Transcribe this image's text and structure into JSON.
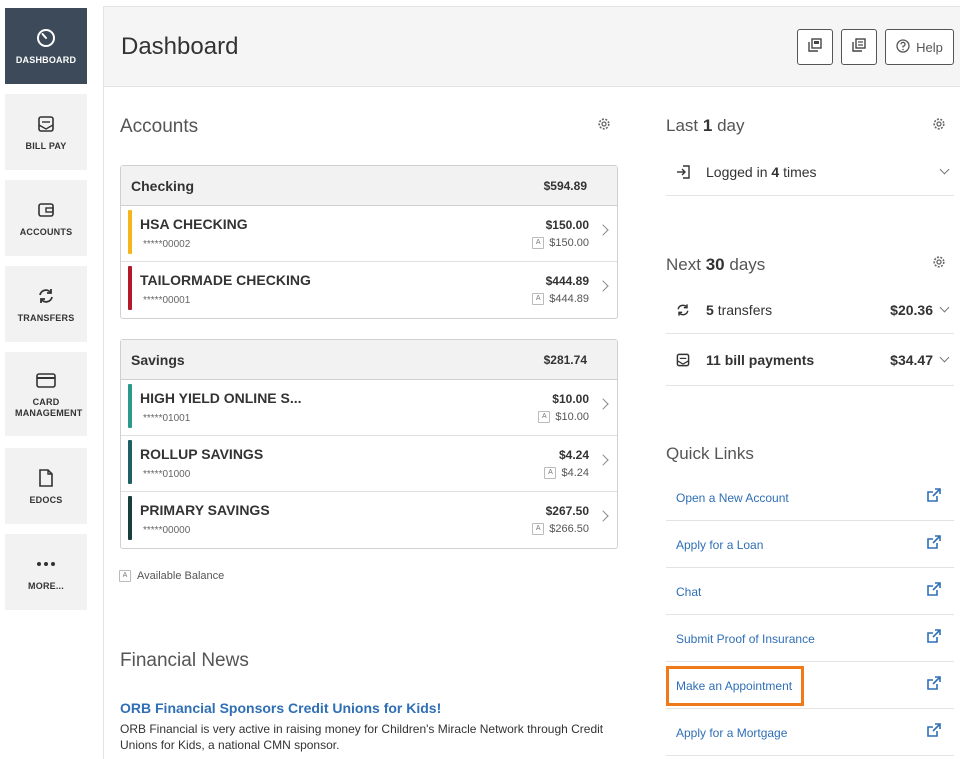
{
  "sidebar": {
    "items": [
      {
        "label": "DASHBOARD",
        "icon": "dashboard-gauge-icon",
        "active": true
      },
      {
        "label": "BILL PAY",
        "icon": "bill-pay-icon"
      },
      {
        "label": "ACCOUNTS",
        "icon": "wallet-icon"
      },
      {
        "label": "TRANSFERS",
        "icon": "transfer-arrows-icon"
      },
      {
        "label": "CARD MANAGEMENT",
        "icon": "credit-card-icon"
      },
      {
        "label": "EDOCS",
        "icon": "document-icon"
      },
      {
        "label": "MORE...",
        "icon": "more-dots-icon"
      }
    ]
  },
  "header": {
    "title": "Dashboard",
    "help_label": "Help"
  },
  "accounts": {
    "title": "Accounts",
    "groups": [
      {
        "name": "Checking",
        "total": "$594.89",
        "rows": [
          {
            "name": "HSA CHECKING",
            "number": "*****00002",
            "balance": "$150.00",
            "available": "$150.00",
            "color": "#f5b51b"
          },
          {
            "name": "TAILORMADE CHECKING",
            "number": "*****00001",
            "balance": "$444.89",
            "available": "$444.89",
            "color": "#b3182b"
          }
        ]
      },
      {
        "name": "Savings",
        "total": "$281.74",
        "rows": [
          {
            "name": "HIGH YIELD ONLINE S...",
            "number": "*****01001",
            "balance": "$10.00",
            "available": "$10.00",
            "color": "#2a9a8c"
          },
          {
            "name": "ROLLUP SAVINGS",
            "number": "*****01000",
            "balance": "$4.24",
            "available": "$4.24",
            "color": "#1d5f63"
          },
          {
            "name": "PRIMARY SAVINGS",
            "number": "*****00000",
            "balance": "$267.50",
            "available": "$266.50",
            "color": "#173d3c"
          }
        ]
      }
    ],
    "badge": "A",
    "legend": "Available Balance"
  },
  "news": {
    "title": "Financial News",
    "headline": "ORB Financial Sponsors Credit Unions for Kids!",
    "body": "ORB Financial is very active in raising money for Children's Miracle Network through Credit Unions for Kids, a national CMN sponsor."
  },
  "last_day": {
    "prefix": "Last",
    "count": "1",
    "suffix": "day",
    "login_prefix": "Logged in",
    "login_count": "4",
    "login_suffix": "times"
  },
  "next_days": {
    "prefix": "Next",
    "count": "30",
    "suffix": "days",
    "transfers_count": "5",
    "transfers_label": "transfers",
    "transfers_amount": "$20.36",
    "bills_label": "11 bill payments",
    "bills_amount": "$34.47"
  },
  "quick_links": {
    "title": "Quick Links",
    "items": [
      "Open a New Account",
      "Apply for a Loan",
      "Chat",
      "Submit Proof of Insurance",
      "Make an Appointment",
      "Apply for a Mortgage"
    ]
  },
  "colors": {
    "sidebar_active": "#3c4a59",
    "link": "#2f6fb5",
    "highlight": "#f07a1a"
  }
}
